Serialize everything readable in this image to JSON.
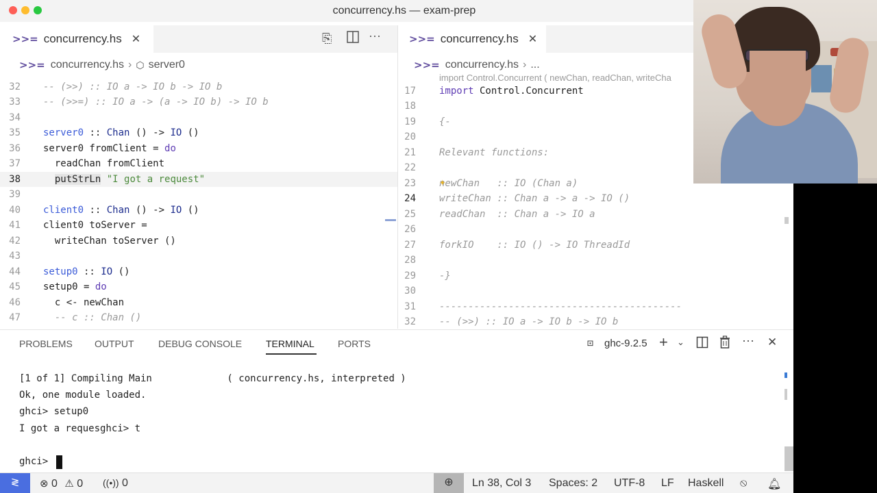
{
  "window": {
    "title": "concurrency.hs — exam-prep"
  },
  "left_editor": {
    "tab_label": "concurrency.hs",
    "breadcrumb_file": "concurrency.hs",
    "breadcrumb_symbol": "server0",
    "lines": [
      "32",
      "33",
      "34",
      "35",
      "36",
      "37",
      "38",
      "39",
      "40",
      "41",
      "42",
      "43",
      "44",
      "45",
      "46",
      "47"
    ],
    "current_line": "38"
  },
  "right_editor": {
    "tab_label": "concurrency.hs",
    "breadcrumb_file": "concurrency.hs",
    "breadcrumb_more": "...",
    "sticky_header": "import Control.Concurrent ( newChan, readChan, writeCha",
    "lines": [
      "17",
      "18",
      "19",
      "20",
      "21",
      "22",
      "23",
      "24",
      "25",
      "26",
      "27",
      "28",
      "29",
      "30",
      "31",
      "32"
    ],
    "current_line": "24"
  },
  "panel": {
    "tabs": [
      "PROBLEMS",
      "OUTPUT",
      "DEBUG CONSOLE",
      "TERMINAL",
      "PORTS"
    ],
    "active_tab": "TERMINAL",
    "terminal_name": "ghc-9.2.5",
    "terminal_lines": [
      "[1 of 1] Compiling Main             ( concurrency.hs, interpreted )",
      "Ok, one module loaded.",
      "ghci> setup0",
      "I got a requesghci> t",
      "",
      "ghci> "
    ]
  },
  "status_bar": {
    "errors": "0",
    "warnings": "0",
    "ports": "0",
    "cursor": "Ln 38, Col 3",
    "spaces": "Spaces: 2",
    "encoding": "UTF-8",
    "eol": "LF",
    "language": "Haskell"
  }
}
